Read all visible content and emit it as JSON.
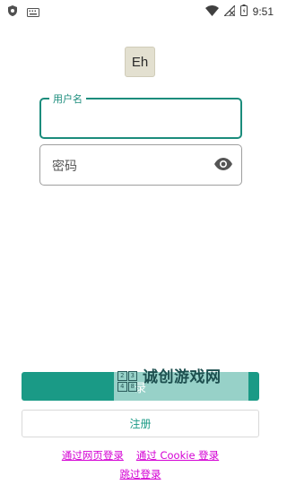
{
  "status_bar": {
    "time": "9:51",
    "icons": [
      "shield-icon",
      "keyboard-icon",
      "wifi-icon",
      "signal-off-icon",
      "battery-icon"
    ]
  },
  "logo": {
    "text": "Eh"
  },
  "username": {
    "label": "用户名",
    "value": ""
  },
  "password": {
    "placeholder": "密码",
    "toggle_icon": "eye-icon"
  },
  "login_button": {
    "label": "录"
  },
  "watermark": {
    "text": "诚创游戏网",
    "grid": [
      "2",
      "3",
      "4",
      "8"
    ]
  },
  "register_button": {
    "label": "注册"
  },
  "links": {
    "web_login": "通过网页登录",
    "cookie_login": "通过 Cookie 登录",
    "skip_login": "跳过登录"
  },
  "colors": {
    "accent": "#1a9a86",
    "link": "#d400d4"
  }
}
